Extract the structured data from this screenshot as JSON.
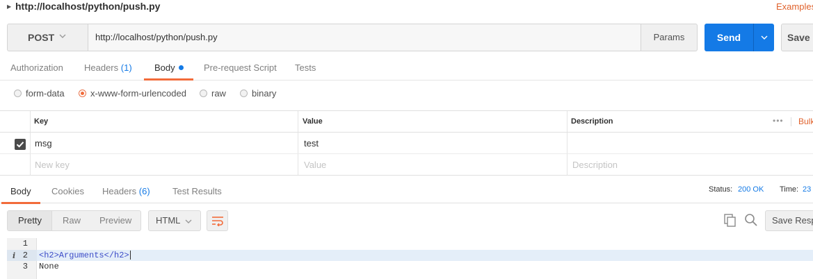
{
  "request": {
    "title": "http://localhost/python/push.py",
    "examples_label": "Examples",
    "method": "POST",
    "url": "http://localhost/python/push.py",
    "params_label": "Params",
    "send_label": "Send",
    "save_label": "Save"
  },
  "request_tabs": [
    {
      "label": "Authorization"
    },
    {
      "label": "Headers",
      "count": "(1)"
    },
    {
      "label": "Body",
      "active": true
    },
    {
      "label": "Pre-request Script"
    },
    {
      "label": "Tests"
    }
  ],
  "body_types": [
    {
      "label": "form-data"
    },
    {
      "label": "x-www-form-urlencoded",
      "checked": true
    },
    {
      "label": "raw"
    },
    {
      "label": "binary"
    }
  ],
  "kv_table": {
    "headers": {
      "key": "Key",
      "value": "Value",
      "description": "Description"
    },
    "bulk_edit_label": "Bulk",
    "rows": [
      {
        "checked": true,
        "key": "msg",
        "value": "test",
        "description": ""
      }
    ],
    "placeholders": {
      "key": "New key",
      "value": "Value",
      "description": "Description"
    }
  },
  "response_tabs": [
    {
      "label": "Body",
      "active": true
    },
    {
      "label": "Cookies"
    },
    {
      "label": "Headers",
      "count": "(6)"
    },
    {
      "label": "Test Results"
    }
  ],
  "response_meta": {
    "status_label": "Status:",
    "status_value": "200 OK",
    "time_label": "Time:",
    "time_value": "23"
  },
  "response_view": {
    "modes": [
      "Pretty",
      "Raw",
      "Preview"
    ],
    "active_mode": "Pretty",
    "format": "HTML",
    "save_response_label": "Save Respo"
  },
  "code": {
    "line_numbers": [
      "1",
      "2",
      "3"
    ],
    "lines": [
      "",
      "<h2>Arguments</h2>",
      "None"
    ]
  },
  "colors": {
    "accent_orange": "#f26b3a",
    "send_blue": "#147ae6"
  }
}
